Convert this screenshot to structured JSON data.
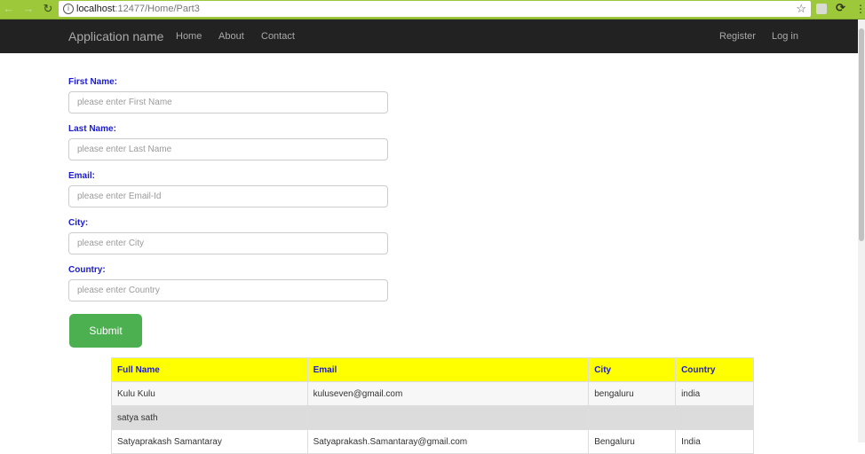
{
  "browser": {
    "url_host": "localhost",
    "url_path": ":12477/Home/Part3"
  },
  "navbar": {
    "brand": "Application name",
    "links": [
      "Home",
      "About",
      "Contact"
    ],
    "right_links": [
      "Register",
      "Log in"
    ]
  },
  "form": {
    "fields": [
      {
        "label": "First Name:",
        "placeholder": "please enter First Name",
        "value": ""
      },
      {
        "label": "Last Name:",
        "placeholder": "please enter Last Name",
        "value": ""
      },
      {
        "label": "Email:",
        "placeholder": "please enter Email-Id",
        "value": ""
      },
      {
        "label": "City:",
        "placeholder": "please enter City",
        "value": ""
      },
      {
        "label": "Country:",
        "placeholder": "please enter Country",
        "value": ""
      }
    ],
    "submit_label": "Submit"
  },
  "table": {
    "headers": [
      "Full Name",
      "Email",
      "City",
      "Country"
    ],
    "rows": [
      [
        "Kulu Kulu",
        "kuluseven@gmail.com",
        "bengaluru",
        "india"
      ],
      [
        "satya sath",
        "",
        "",
        ""
      ],
      [
        "Satyaprakash Samantaray",
        "Satyaprakash.Samantaray@gmail.com",
        "Bengaluru",
        "India"
      ]
    ]
  },
  "colors": {
    "label": "#1a1ad0",
    "header_bg": "#ffff00",
    "submit_bg": "#4caf50",
    "navbar_bg": "#222222",
    "chrome_bg": "#9cc83a"
  }
}
